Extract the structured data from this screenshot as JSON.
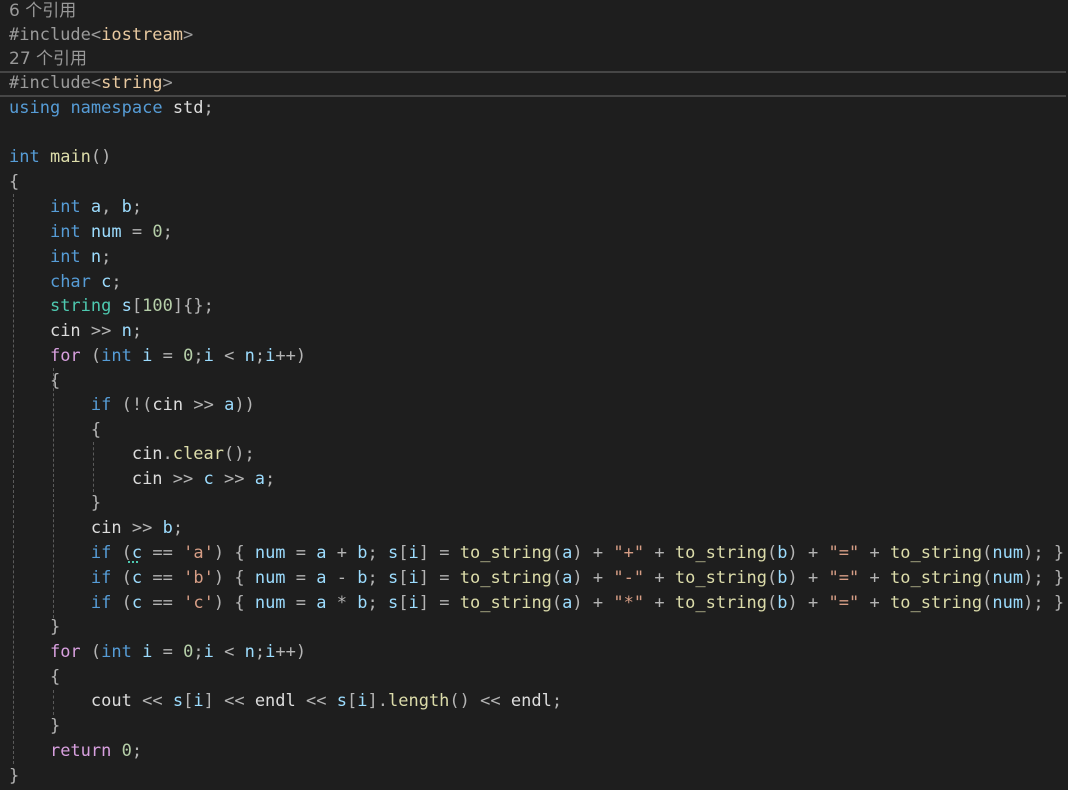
{
  "lenses": {
    "line1": "6 个引用",
    "line2": "27 个引用"
  },
  "code_lines": [
    "#include<iostream>",
    "#include<string>",
    "using namespace std;",
    "",
    "int main()",
    "{",
    "    int a, b;",
    "    int num = 0;",
    "    int n;",
    "    char c;",
    "    string s[100]{};",
    "    cin >> n;",
    "    for (int i = 0;i < n;i++)",
    "    {",
    "        if (!(cin >> a))",
    "        {",
    "            cin.clear();",
    "            cin >> c >> a;",
    "        }",
    "        cin >> b;",
    "        if (c == 'a') { num = a + b; s[i] = to_string(a) + \"+\" + to_string(b) + \"=\" + to_string(num); }",
    "        if (c == 'b') { num = a - b; s[i] = to_string(a) + \"-\" + to_string(b) + \"=\" + to_string(num); }",
    "        if (c == 'c') { num = a * b; s[i] = to_string(a) + \"*\" + to_string(b) + \"=\" + to_string(num); }",
    "    }",
    "    for (int i = 0;i < n;i++)",
    "    {",
    "        cout << s[i] << endl << s[i].length() << endl;",
    "    }",
    "    return 0;",
    "}"
  ],
  "colors": {
    "background": "#1e1e1e",
    "keyword": "#569cd6",
    "control_keyword": "#d8a0df",
    "function": "#dcdcaa",
    "variable": "#9cdcfe",
    "number": "#b5cea8",
    "string": "#d69d85",
    "type": "#4ec9b0",
    "preprocessor": "#9b9b9b"
  }
}
